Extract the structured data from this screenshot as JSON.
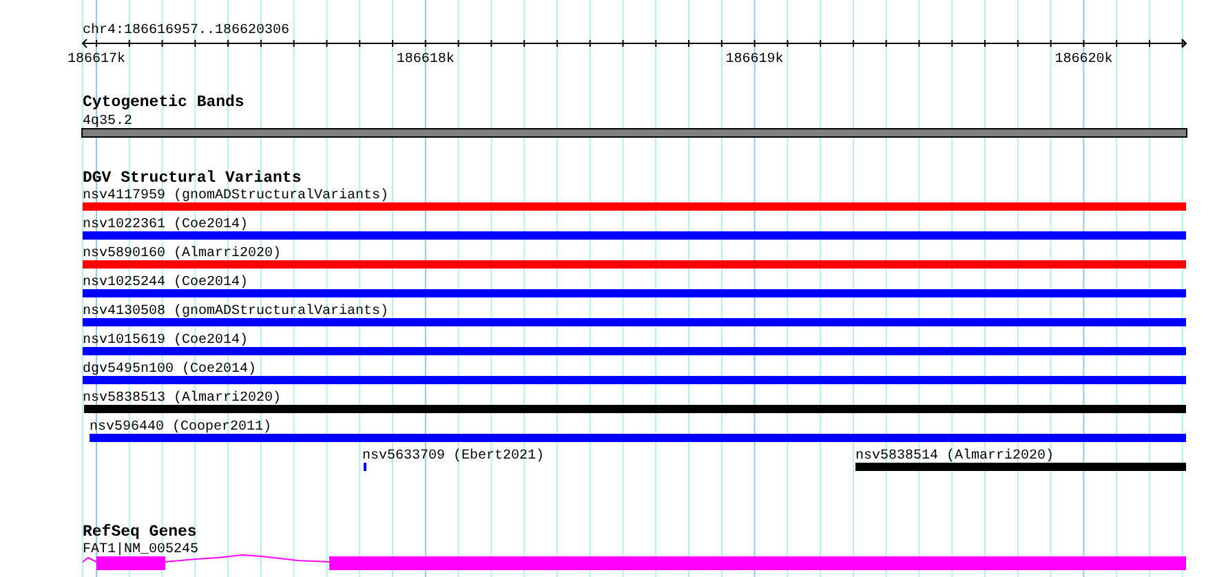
{
  "location": "chr4:186616957..186620306",
  "axis": {
    "ticks": [
      "186617k",
      "186618k",
      "186619k",
      "186620k"
    ]
  },
  "tracks": [
    {
      "kind": "cytoband",
      "title": "Cytogenetic Bands",
      "features": [
        {
          "label": "4q35.2",
          "color": "#808080"
        }
      ]
    },
    {
      "kind": "variants",
      "title": "DGV Structural Variants",
      "features": [
        {
          "label": "nsv4117959 (gnomADStructuralVariants)",
          "color": "#ff0000"
        },
        {
          "label": "nsv1022361 (Coe2014)",
          "color": "#0000ff"
        },
        {
          "label": "nsv5890160 (Almarri2020)",
          "color": "#ff0000"
        },
        {
          "label": "nsv1025244 (Coe2014)",
          "color": "#0000ff"
        },
        {
          "label": "nsv4130508 (gnomADStructuralVariants)",
          "color": "#0000ff"
        },
        {
          "label": "nsv1015619 (Coe2014)",
          "color": "#0000ff"
        },
        {
          "label": "dgv5495n100 (Coe2014)",
          "color": "#0000ff"
        },
        {
          "label": "nsv5838513 (Almarri2020)",
          "color": "#000000"
        },
        {
          "label": "nsv596440 (Cooper2011)",
          "color": "#0000ff"
        },
        {
          "label": "nsv5633709 (Ebert2021)",
          "color": "#0000ff"
        },
        {
          "label": "nsv5838514 (Almarri2020)",
          "color": "#000000"
        }
      ]
    },
    {
      "kind": "genes",
      "title": "RefSeq Genes",
      "features": [
        {
          "label": "FAT1|NM_005245",
          "color": "#ff00ff"
        }
      ]
    }
  ]
}
